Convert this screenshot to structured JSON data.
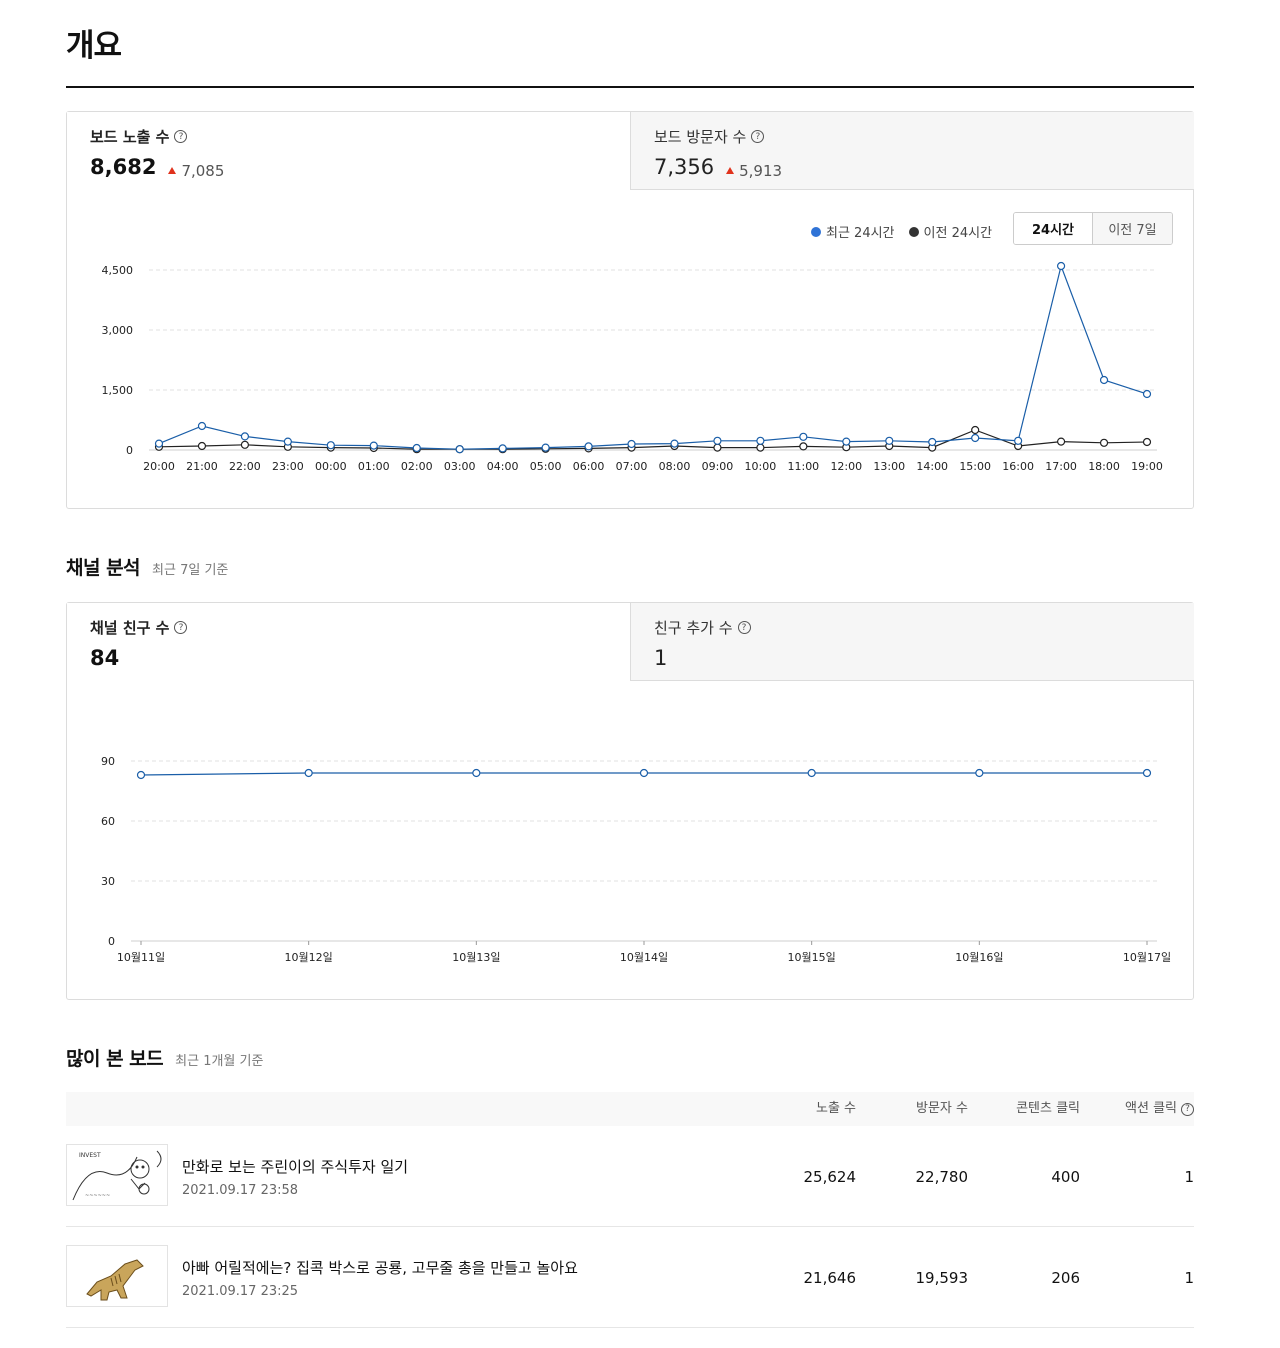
{
  "page": {
    "title": "개요"
  },
  "overview": {
    "left_stat": {
      "label": "보드 노출 수",
      "help": "?",
      "value": "8,682",
      "delta": "7,085"
    },
    "right_stat": {
      "label": "보드 방문자 수",
      "help": "?",
      "value": "7,356",
      "delta": "5,913"
    },
    "legend": {
      "current": "최근 24시간",
      "previous": "이전 24시간"
    },
    "range": {
      "active": "24시간",
      "inactive": "이전 7일"
    },
    "colors": {
      "current": "#1a5ea8",
      "previous": "#222222",
      "current_dot": "#2f73d6"
    }
  },
  "channel": {
    "title": "채널 분석",
    "subtitle": "최근 7일 기준",
    "left_stat": {
      "label": "채널 친구 수",
      "help": "?",
      "value": "84"
    },
    "right_stat": {
      "label": "친구 추가 수",
      "help": "?",
      "value": "1"
    }
  },
  "boards": {
    "title": "많이 본 보드",
    "subtitle": "최근 1개월 기준",
    "columns": [
      "노출 수",
      "방문자 수",
      "콘텐츠 클릭",
      "액션 클릭"
    ],
    "rows": [
      {
        "title": "만화로 보는 주린이의 주식투자 일기",
        "date": "2021.09.17 23:58",
        "impressions": "25,624",
        "visitors": "22,780",
        "content_clicks": "400",
        "action_clicks": "1",
        "thumb_icon": "comic-sketch-icon"
      },
      {
        "title": "아빠 어릴적에는? 집콕 박스로 공룡, 고무줄 총을 만들고 놀아요",
        "date": "2021.09.17 23:25",
        "impressions": "21,646",
        "visitors": "19,593",
        "content_clicks": "206",
        "action_clicks": "1",
        "thumb_icon": "dinosaur-icon"
      }
    ]
  },
  "chart_data": [
    {
      "type": "line",
      "x": [
        "20:00",
        "21:00",
        "22:00",
        "23:00",
        "00:00",
        "01:00",
        "02:00",
        "03:00",
        "04:00",
        "05:00",
        "06:00",
        "07:00",
        "08:00",
        "09:00",
        "10:00",
        "11:00",
        "12:00",
        "13:00",
        "14:00",
        "15:00",
        "16:00",
        "17:00",
        "18:00",
        "19:00"
      ],
      "series": [
        {
          "name": "최근 24시간",
          "values": [
            160,
            600,
            340,
            210,
            120,
            110,
            50,
            20,
            40,
            60,
            90,
            150,
            160,
            230,
            230,
            330,
            210,
            230,
            200,
            300,
            230,
            4600,
            1750,
            1400
          ]
        },
        {
          "name": "이전 24시간",
          "values": [
            80,
            100,
            130,
            80,
            60,
            50,
            20,
            20,
            20,
            30,
            40,
            60,
            100,
            60,
            60,
            90,
            70,
            100,
            60,
            500,
            100,
            210,
            180,
            200
          ]
        }
      ],
      "yticks": [
        "4,500",
        "3,000",
        "1,500",
        "0"
      ],
      "ylim": [
        0,
        6000
      ],
      "grid": true,
      "legend": "top-right"
    },
    {
      "type": "line",
      "x": [
        "10월11일",
        "10월12일",
        "10월13일",
        "10월14일",
        "10월15일",
        "10월16일",
        "10월17일"
      ],
      "series": [
        {
          "values": [
            83,
            84,
            84,
            84,
            84,
            84,
            84
          ]
        }
      ],
      "yticks": [
        "90",
        "60",
        "30",
        "0"
      ],
      "ylim": [
        0,
        90
      ],
      "grid": true
    }
  ]
}
